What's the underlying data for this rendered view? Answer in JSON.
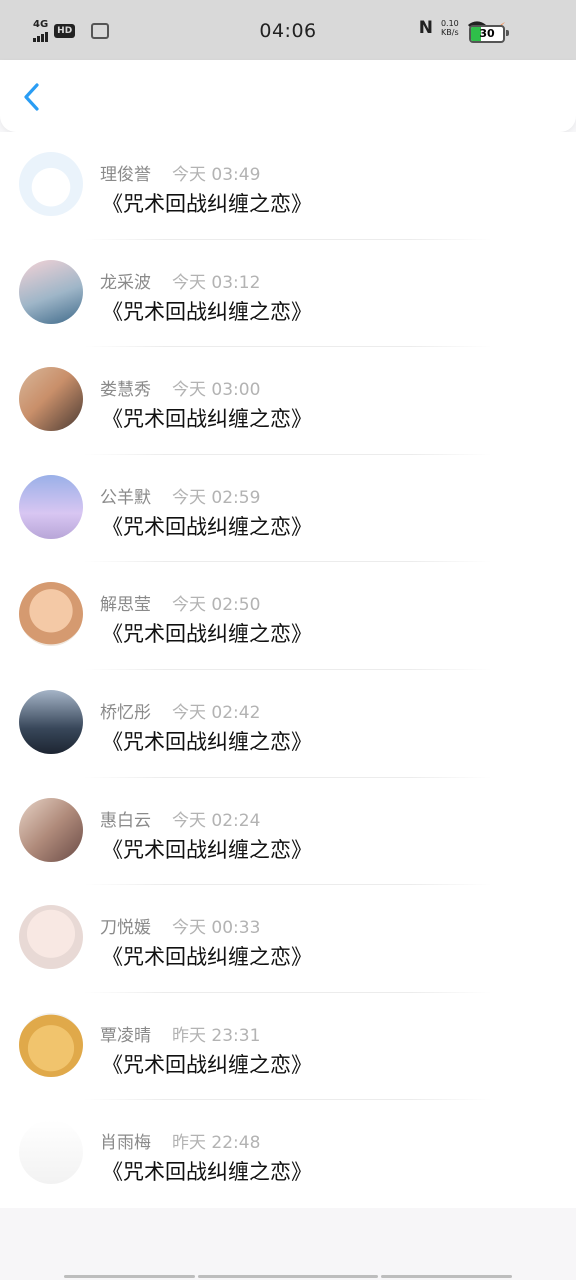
{
  "status_bar": {
    "network": "4G",
    "hd": "HD",
    "time": "04:06",
    "nfc": "N",
    "speed_value": "0.10",
    "speed_unit": "KB/s",
    "battery": "30",
    "icons": [
      "signal-icon",
      "hd-icon",
      "app-notification-icon",
      "nfc-icon",
      "wifi-icon",
      "charging-icon",
      "battery-icon"
    ]
  },
  "header": {
    "back_icon": "chevron-left-icon",
    "accent": "#2a9df4"
  },
  "entries": [
    {
      "name": "理俊誉",
      "time": "今天 03:49",
      "title": "《咒术回战纠缠之恋》"
    },
    {
      "name": "龙采波",
      "time": "今天 03:12",
      "title": "《咒术回战纠缠之恋》"
    },
    {
      "name": "娄慧秀",
      "time": "今天 03:00",
      "title": "《咒术回战纠缠之恋》"
    },
    {
      "name": "公羊默",
      "time": "今天 02:59",
      "title": "《咒术回战纠缠之恋》"
    },
    {
      "name": "解思莹",
      "time": "今天 02:50",
      "title": "《咒术回战纠缠之恋》"
    },
    {
      "name": "桥忆彤",
      "time": "今天 02:42",
      "title": "《咒术回战纠缠之恋》"
    },
    {
      "name": "惠白云",
      "time": "今天 02:24",
      "title": "《咒术回战纠缠之恋》"
    },
    {
      "name": "刀悦媛",
      "time": "今天 00:33",
      "title": "《咒术回战纠缠之恋》"
    },
    {
      "name": "覃凌晴",
      "time": "昨天 23:31",
      "title": "《咒术回战纠缠之恋》"
    },
    {
      "name": "肖雨梅",
      "time": "昨天 22:48",
      "title": "《咒术回战纠缠之恋》"
    }
  ]
}
